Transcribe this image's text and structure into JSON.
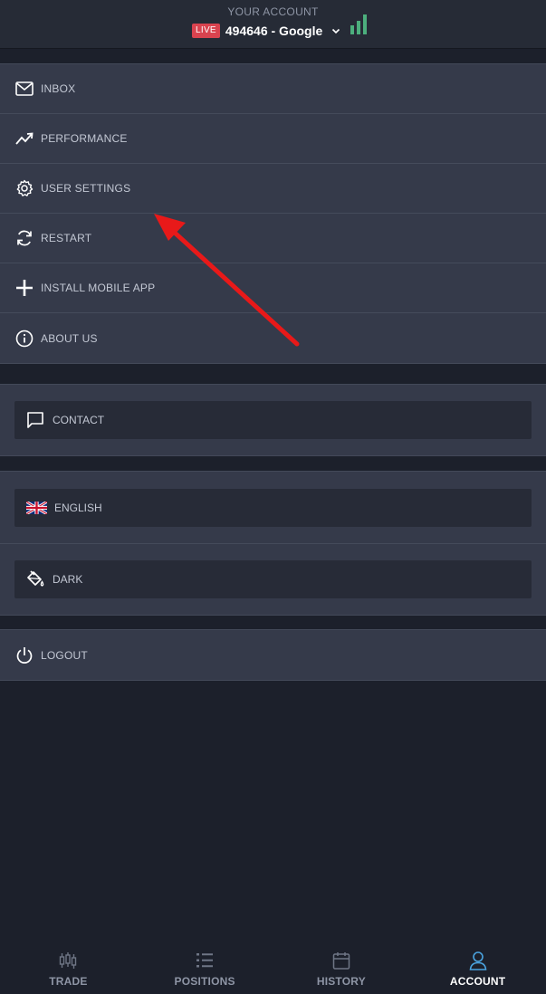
{
  "header": {
    "label": "YOUR ACCOUNT",
    "live_badge": "LIVE",
    "account_name": "494646 - Google"
  },
  "menu": {
    "items": [
      {
        "label": "INBOX",
        "icon": "mail-icon"
      },
      {
        "label": "PERFORMANCE",
        "icon": "trend-icon"
      },
      {
        "label": "USER SETTINGS",
        "icon": "gear-icon"
      },
      {
        "label": "RESTART",
        "icon": "refresh-icon"
      },
      {
        "label": "INSTALL MOBILE APP",
        "icon": "plus-icon"
      },
      {
        "label": "ABOUT US",
        "icon": "info-icon"
      }
    ]
  },
  "contact": {
    "label": "CONTACT",
    "icon": "chat-icon"
  },
  "preferences": {
    "language": {
      "label": "ENGLISH",
      "icon": "uk-flag-icon"
    },
    "theme": {
      "label": "DARK",
      "icon": "paint-bucket-icon"
    }
  },
  "logout": {
    "label": "LOGOUT",
    "icon": "power-icon"
  },
  "tabs": [
    {
      "label": "TRADE",
      "icon": "candlestick-icon",
      "active": false
    },
    {
      "label": "POSITIONS",
      "icon": "list-icon",
      "active": false
    },
    {
      "label": "HISTORY",
      "icon": "calendar-icon",
      "active": false
    },
    {
      "label": "ACCOUNT",
      "icon": "user-icon",
      "active": true
    }
  ],
  "colors": {
    "background": "#1c202b",
    "panel": "#353a4a",
    "live": "#d9434f",
    "signal": "#4caf7d",
    "accent": "#4aa3df",
    "annotation_arrow": "#e81919"
  }
}
